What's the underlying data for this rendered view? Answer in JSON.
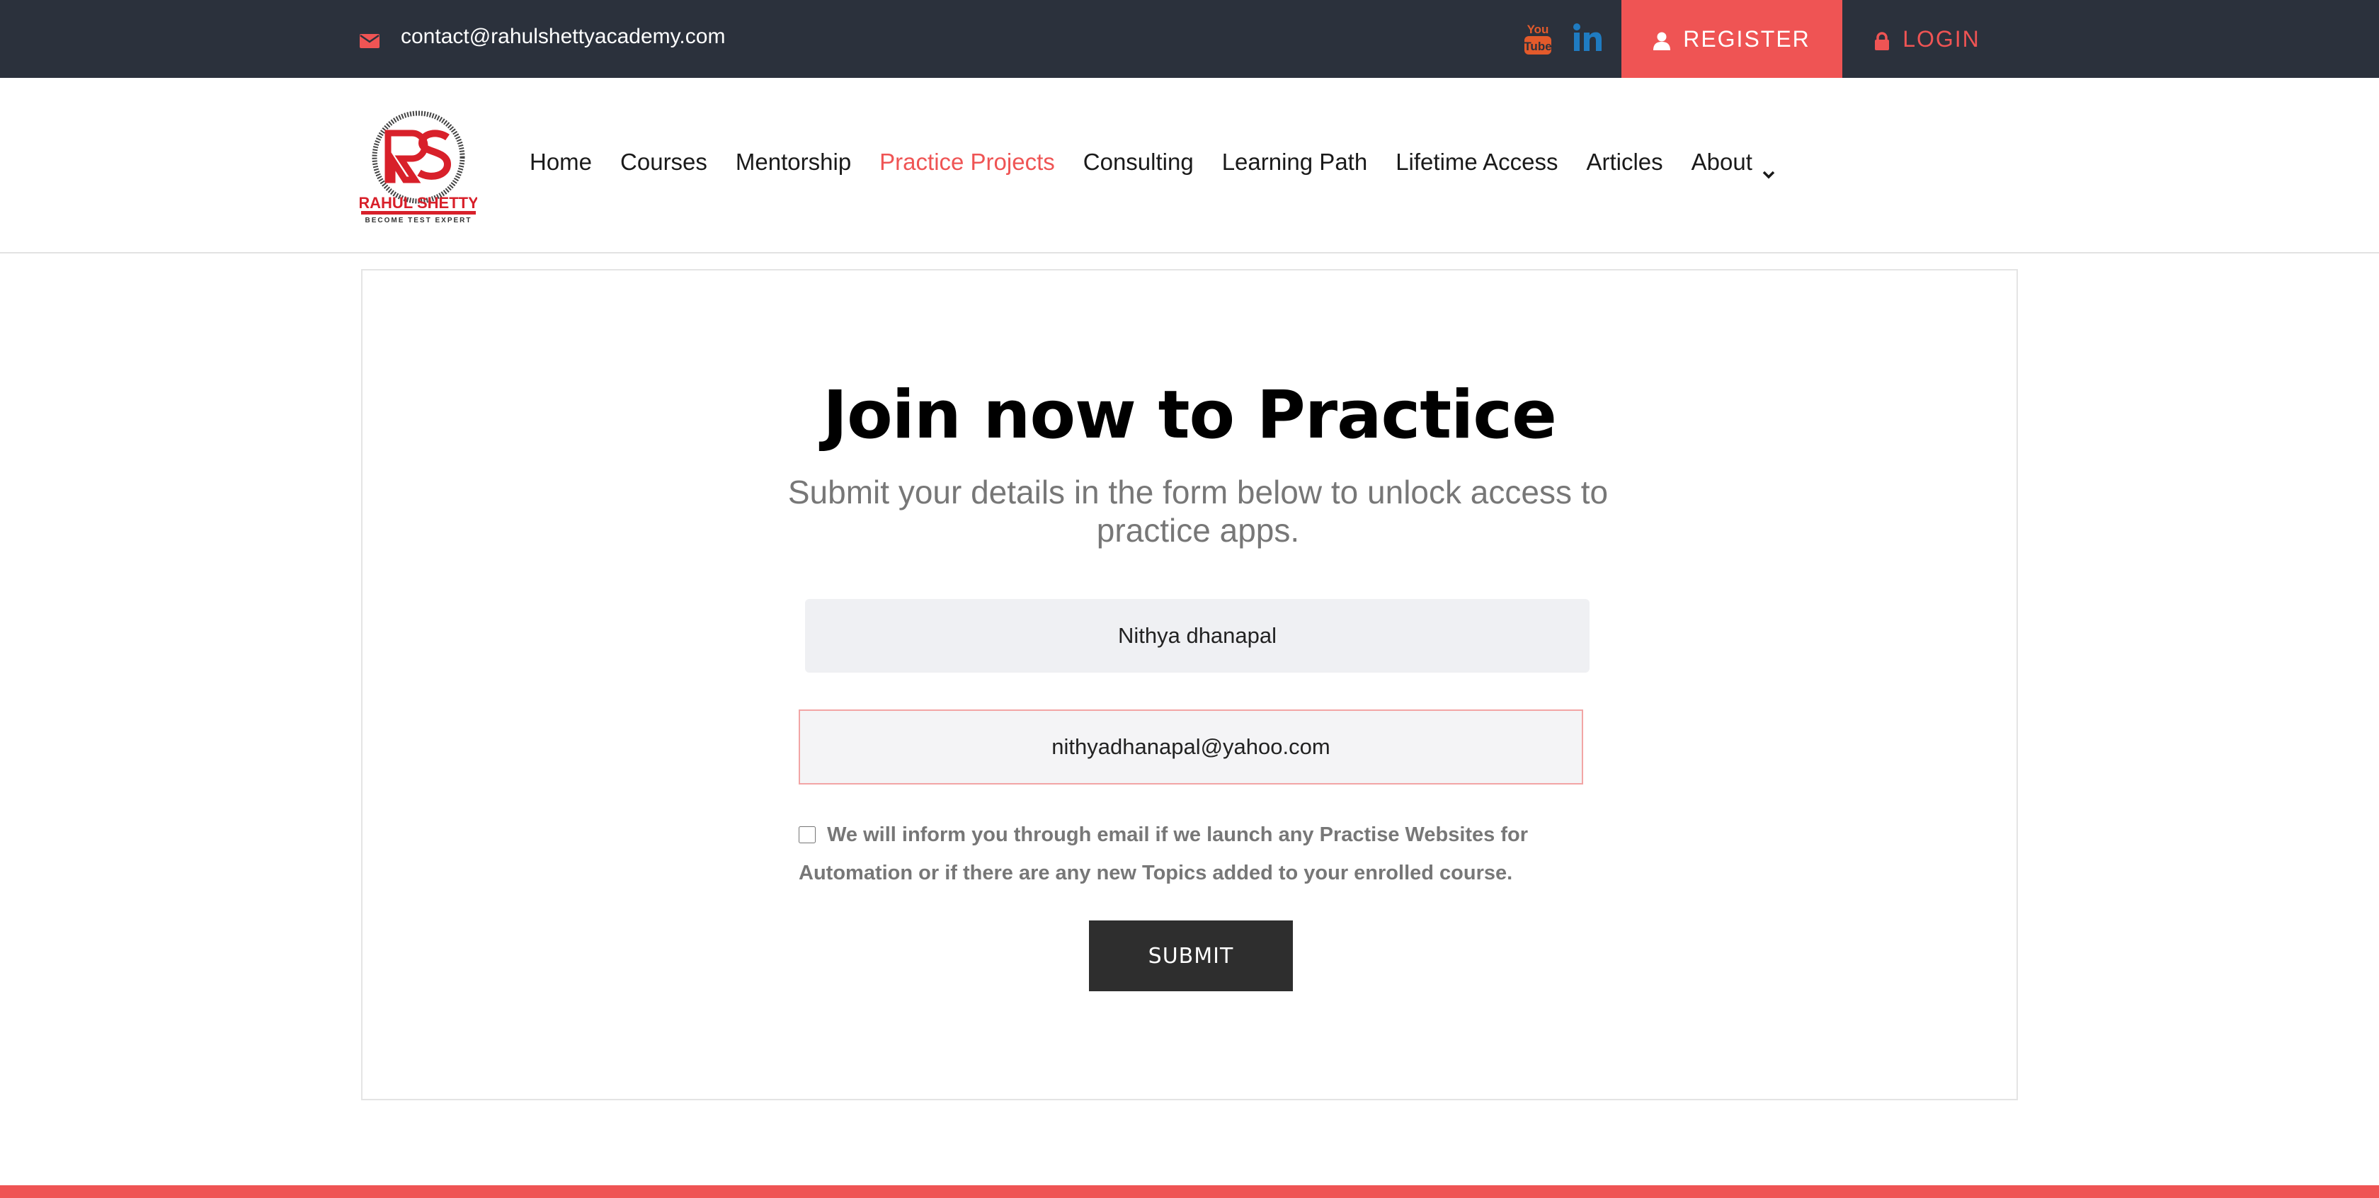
{
  "topbar": {
    "email": "contact@rahulshettyacademy.com",
    "register_label": "REGISTER",
    "login_label": "LOGIN",
    "social": [
      "youtube-icon",
      "linkedin-icon"
    ]
  },
  "header": {
    "logo_initials": "RS",
    "logo_name": "RAHUL SHETTY",
    "logo_tagline": "BECOME TEST EXPERT",
    "nav": [
      {
        "label": "Home"
      },
      {
        "label": "Courses"
      },
      {
        "label": "Mentorship"
      },
      {
        "label": "Practice Projects",
        "active": true
      },
      {
        "label": "Consulting"
      },
      {
        "label": "Learning Path"
      },
      {
        "label": "Lifetime Access"
      },
      {
        "label": "Articles"
      },
      {
        "label": "About"
      }
    ]
  },
  "form": {
    "title": "Join now to Practice",
    "subtitle": "Submit your details in the form below to unlock access to practice apps.",
    "name_value": "Nithya dhanapal",
    "email_value": "nithyadhanapal@yahoo.com",
    "consent_text": "We will inform you through email if we launch any Practise Websites for Automation or if there are any new Topics added to your enrolled course.",
    "consent_checked": false,
    "submit_label": "SUBMIT"
  },
  "colors": {
    "accent": "#ef5454",
    "topbar_bg": "#2b313c",
    "button_dark": "#2e2e2e",
    "linkedin": "#1f7bc1"
  }
}
